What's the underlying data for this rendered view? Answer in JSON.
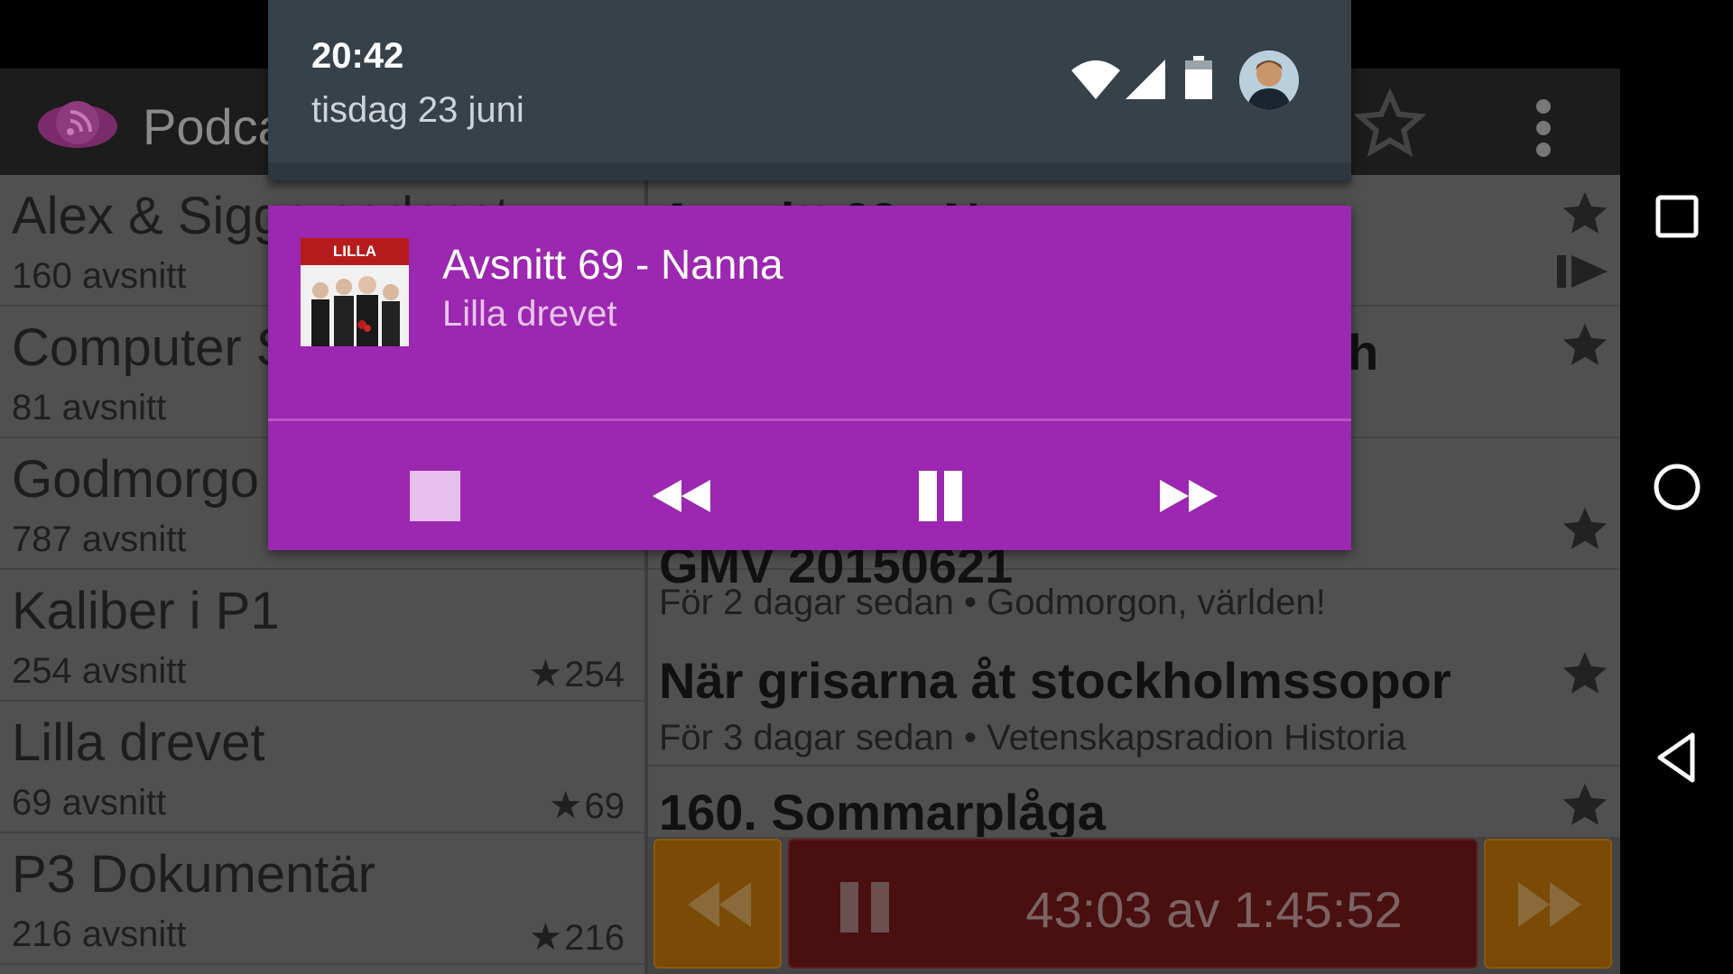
{
  "app": {
    "title": "Podca"
  },
  "notification": {
    "time": "20:42",
    "date": "tisdag 23 juni"
  },
  "media": {
    "episode_title": "Avsnitt 69 - Nanna",
    "podcast_name": "Lilla drevet",
    "album_art_text": "LILLA DREVET",
    "controls": [
      "stop",
      "rewind",
      "pause",
      "fast-forward"
    ]
  },
  "podcasts": [
    {
      "name": "Alex & Sigge podcast",
      "count": "160 avsnitt",
      "stars": ""
    },
    {
      "name": "Computer S",
      "count": "81 avsnitt",
      "stars": ""
    },
    {
      "name": "Godmorgo",
      "count": "787 avsnitt",
      "stars": ""
    },
    {
      "name": "Kaliber i P1",
      "count": "254 avsnitt",
      "stars": "254"
    },
    {
      "name": "Lilla drevet",
      "count": "69 avsnitt",
      "stars": "69"
    },
    {
      "name": "P3 Dokumentär",
      "count": "216 avsnitt",
      "stars": "216"
    }
  ],
  "episodes": [
    {
      "title": "Avsnitt 69 - Nanna",
      "sub": ""
    },
    {
      "title": "ch",
      "sub": ""
    },
    {
      "title": "",
      "sub": ""
    },
    {
      "title": "GMV 20150621",
      "sub": "För 2 dagar sedan • Godmorgon, världen!"
    },
    {
      "title": "När grisarna åt stockholmssopor",
      "sub": "För 3 dagar sedan • Vetenskapsradion Historia"
    },
    {
      "title": "160. Sommarplåga",
      "sub": ""
    }
  ],
  "player": {
    "time": "43:03 av 1:45:52"
  },
  "colors": {
    "media_card": "#9c27b0",
    "shade": "#37414a",
    "player_orange": "#7a4a06",
    "player_red": "#4a0f0f"
  }
}
